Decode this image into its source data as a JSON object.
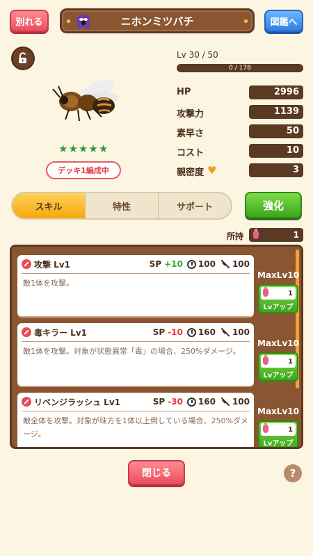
{
  "header": {
    "leave_label": "別れる",
    "title": "ニホンミツバチ",
    "encyclopedia_label": "図鑑へ"
  },
  "character": {
    "level_text": "Lv 30 / 50",
    "exp_text": "0 / 178",
    "exp_progress": 0.0,
    "stars": 5,
    "deck_badge": "デッキ1編成中"
  },
  "stats": [
    {
      "label": "HP",
      "value": "2996"
    },
    {
      "label": "攻撃力",
      "value": "1139"
    },
    {
      "label": "素早さ",
      "value": "50"
    },
    {
      "label": "コスト",
      "value": "10"
    },
    {
      "label": "親密度",
      "value": "3"
    }
  ],
  "tabs": [
    {
      "label": "スキル",
      "active": true
    },
    {
      "label": "特性",
      "active": false
    },
    {
      "label": "サポート",
      "active": false
    }
  ],
  "enhance_label": "強化",
  "owned": {
    "label": "所持",
    "value": "1"
  },
  "skills": [
    {
      "name": "攻撃 Lv1",
      "sp_label": "SP",
      "sp": "+10",
      "sp_color": "#2eaa2e",
      "time": "100",
      "power": "100",
      "desc": "敵1体を攻撃。",
      "max": "MaxLv10",
      "count": "1",
      "lvup": "Lvアップ"
    },
    {
      "name": "毒キラー Lv1",
      "sp_label": "SP",
      "sp": "-10",
      "sp_color": "#e23b3b",
      "time": "160",
      "power": "100",
      "desc": "敵1体を攻撃。対象が状態異常「毒」の場合、250%ダメージ。",
      "max": "MaxLv10",
      "count": "1",
      "lvup": "Lvアップ"
    },
    {
      "name": "リベンジラッシュ Lv1",
      "sp_label": "SP",
      "sp": "-30",
      "sp_color": "#e23b3b",
      "time": "160",
      "power": "100",
      "desc": "敵全体を攻撃。対象が味方を1体以上倒している場合、250%ダメージ。",
      "max": "MaxLv10",
      "count": "1",
      "lvup": "Lvアップ"
    }
  ],
  "close_label": "閉じる",
  "help_label": "?",
  "colors": {
    "background": "#fbf5e1",
    "panel": "#8a5632",
    "accent_red": "#ec4f5d",
    "accent_blue": "#2f7fe6",
    "accent_green": "#3ea61b"
  }
}
